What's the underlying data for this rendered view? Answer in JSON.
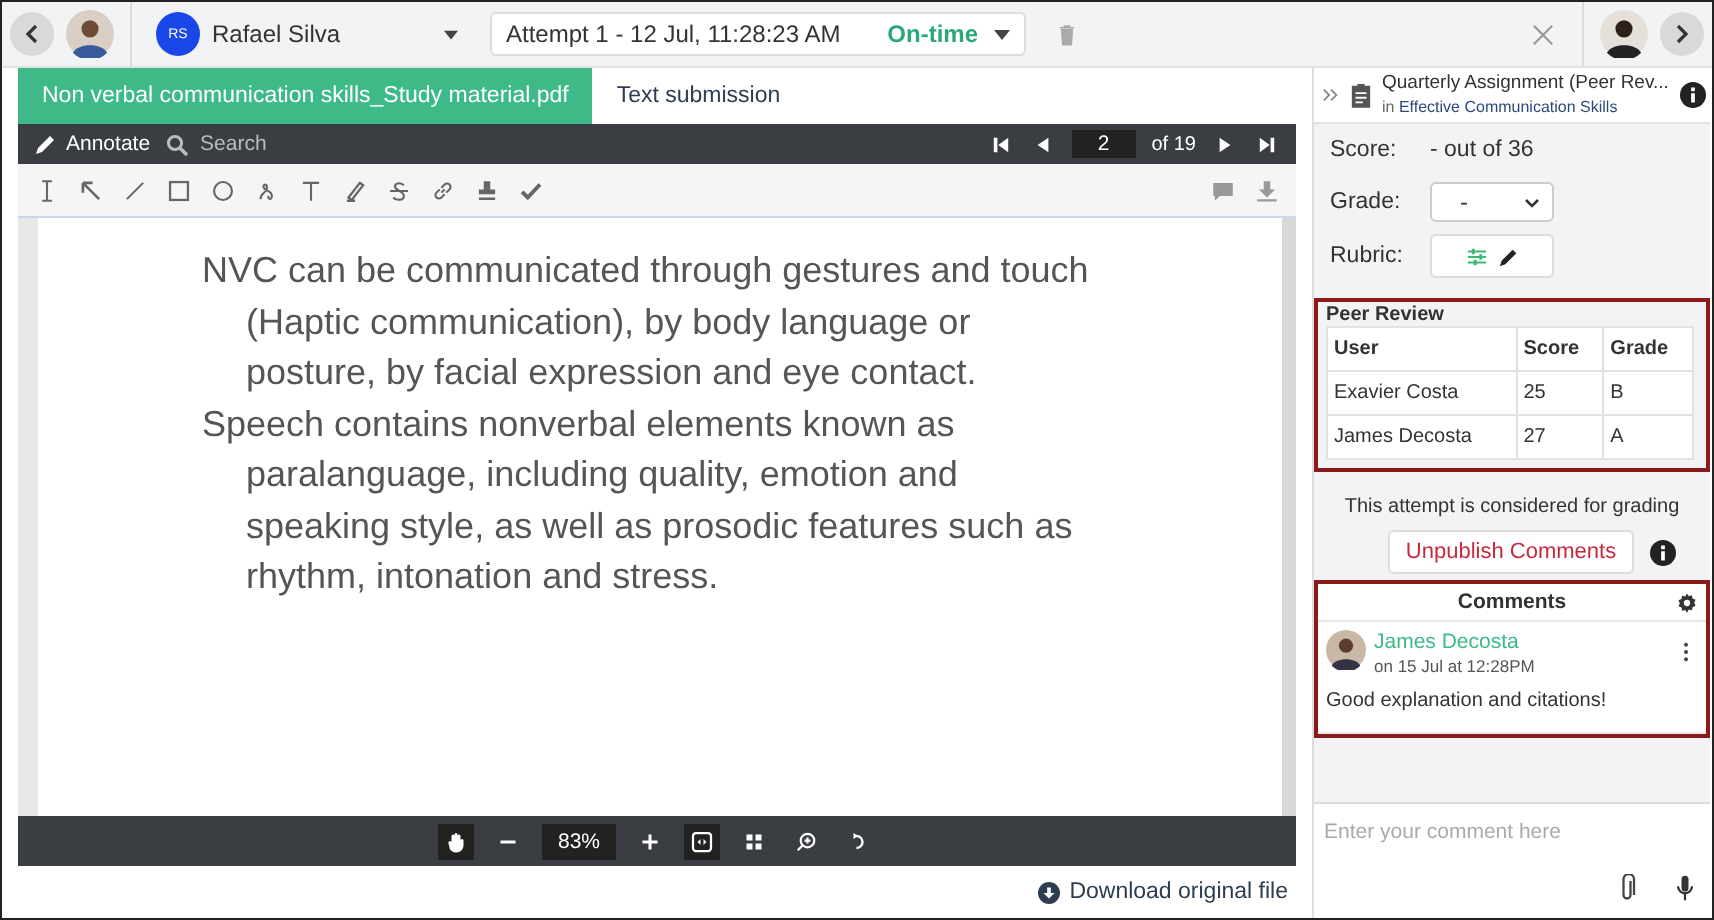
{
  "top_bar": {
    "learner_initials": "RS",
    "learner_name": "Rafael Silva",
    "attempt": "Attempt 1 - 12 Jul, 11:28:23 AM",
    "status": "On-time"
  },
  "tabs": [
    {
      "label": "Non verbal communication skills_Study material.pdf",
      "selected": true
    },
    {
      "label": "Text submission",
      "selected": false
    }
  ],
  "viewer": {
    "annotate_label": "Annotate",
    "search_placeholder": "Search",
    "page": "2",
    "page_count": "of 19",
    "zoom": "83%",
    "paragraphs": [
      "NVC can be communicated through gestures and touch (Haptic communication), by body language or posture, by facial expression and eye contact.",
      "Speech contains nonverbal elements known as paralanguage, including quality, emotion and speaking style, as well as prosodic features such as rhythm, intonation and stress."
    ]
  },
  "download_link": "Download original file",
  "panel": {
    "title": "Quarterly Assignment (Peer Rev...",
    "course_prefix": "in",
    "course": "Effective Communication Skills",
    "score_label": "Score:",
    "score_value": "- out of 36",
    "grade_label": "Grade:",
    "grade_value": "-",
    "rubric_label": "Rubric:"
  },
  "peer_review": {
    "title": "Peer Review",
    "columns": [
      "User",
      "Score",
      "Grade"
    ],
    "rows": [
      [
        "Exavier Costa",
        "25",
        "B"
      ],
      [
        "James Decosta",
        "27",
        "A"
      ]
    ]
  },
  "grading_note": "This attempt is considered for grading",
  "unpublish_button": "Unpublish Comments",
  "comments": {
    "title": "Comments",
    "placeholder": "Enter your comment here",
    "items": [
      {
        "author": "James Decosta",
        "time": "on 15 Jul at 12:28PM",
        "text": "Good explanation and citations!"
      }
    ]
  }
}
